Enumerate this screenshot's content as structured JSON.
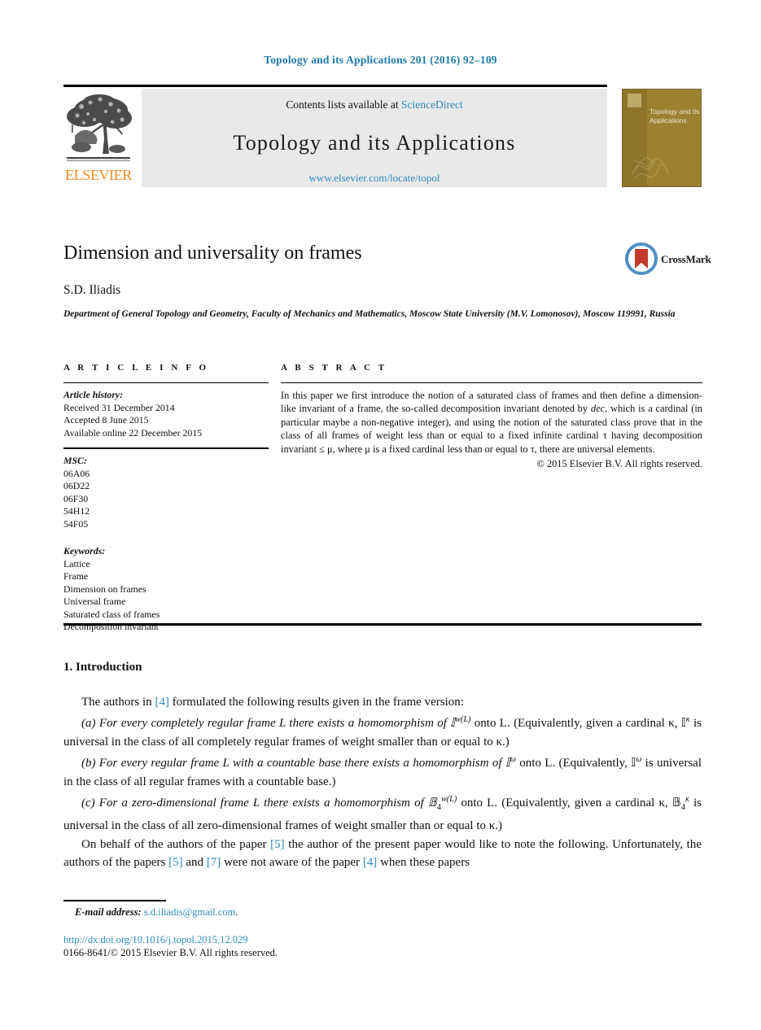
{
  "running_head": "Topology and its Applications 201 (2016) 92–109",
  "masthead": {
    "contents_prefix": "Contents lists available at ",
    "sciencedirect_label": "ScienceDirect",
    "journal_title": "Topology and its Applications",
    "journal_url": "www.elsevier.com/locate/topol",
    "publisher_name": "ELSEVIER",
    "cover_title": "Topology and its Applications",
    "link_color": "#2b8cbe",
    "band_color": "#e9e9e9",
    "cover_color": "#9c8130",
    "elsevier_orange": "#f08a1d"
  },
  "article": {
    "title": "Dimension and universality on frames",
    "author": "S.D. Iliadis",
    "affiliation": "Department of General Topology and Geometry, Faculty of Mechanics and Mathematics, Moscow State University (M.V. Lomonosov), Moscow 119991, Russia",
    "crossmark_label": "CrossMark"
  },
  "info": {
    "heading": "A R T I C L E    I N F O",
    "history_label": "Article history:",
    "history": [
      "Received 31 December 2014",
      "Accepted 8 June 2015",
      "Available online 22 December 2015"
    ],
    "msc_label": "MSC:",
    "msc": [
      "06A06",
      "06D22",
      "06F30",
      "54H12",
      "54F05"
    ],
    "keywords_label": "Keywords:",
    "keywords": [
      "Lattice",
      "Frame",
      "Dimension on frames",
      "Universal frame",
      "Saturated class of frames",
      "Decomposition invariant"
    ]
  },
  "abstract": {
    "heading": "A B S T R A C T",
    "text_part1": "In this paper we first introduce the notion of a saturated class of frames and then define a dimension-like invariant of a frame, the so-called decomposition invariant denoted by ",
    "dec_italic": "dec",
    "text_part2": ", which is a cardinal (in particular maybe a non-negative integer), and using the notion of the saturated class prove that in the class of all frames of weight less than or equal to a fixed infinite cardinal τ having decomposition invariant ≤ μ, where μ is a fixed cardinal less than or equal to τ, there are universal elements.",
    "copyright": "© 2015 Elsevier B.V. All rights reserved."
  },
  "body": {
    "section_heading": "1. Introduction",
    "p0_a": "The authors in ",
    "p0_ref": "[4]",
    "p0_b": " formulated the following results given in the frame version:",
    "p_a_1": "(a) For every completely regular frame L there exists a homomorphism of 𝕀",
    "p_a_sup": "w(L)",
    "p_a_2": " onto L. (Equivalently, given a cardinal κ, 𝕀",
    "p_a_sup2": "κ",
    "p_a_3": " is universal in the class of all completely regular frames of weight smaller than or equal to κ.)",
    "p_b_1": "(b) For every regular frame L with a countable base there exists a homomorphism of 𝕀",
    "p_b_sup": "ω",
    "p_b_2": " onto L. (Equivalently, 𝕀",
    "p_b_sup2": "ω",
    "p_b_3": " is universal in the class of all regular frames with a countable base.)",
    "p_c_1": "(c) For a zero-dimensional frame L there exists a homomorphism of 𝔹",
    "p_c_sub": "4",
    "p_c_sup": "w(L)",
    "p_c_2": " onto L. (Equivalently, given a cardinal κ, 𝔹",
    "p_c_sub2": "4",
    "p_c_sup2": "κ",
    "p_c_3": " is universal in the class of all zero-dimensional frames of weight smaller than or equal to κ.)",
    "p_last_1": "On behalf of the authors of the paper ",
    "p_last_ref1": "[5]",
    "p_last_2": " the author of the present paper would like to note the following. Unfortunately, the authors of the papers ",
    "p_last_ref2": "[5]",
    "p_last_3": " and ",
    "p_last_ref3": "[7]",
    "p_last_4": " were not aware of the paper ",
    "p_last_ref4": "[4]",
    "p_last_5": " when these papers"
  },
  "footer": {
    "email_label": "E-mail address:",
    "email": "s.d.iliadis@gmail.com",
    "email_period": ".",
    "doi": "http://dx.doi.org/10.1016/j.topol.2015.12.029",
    "issn_copyright": "0166-8641/© 2015 Elsevier B.V. All rights reserved."
  }
}
